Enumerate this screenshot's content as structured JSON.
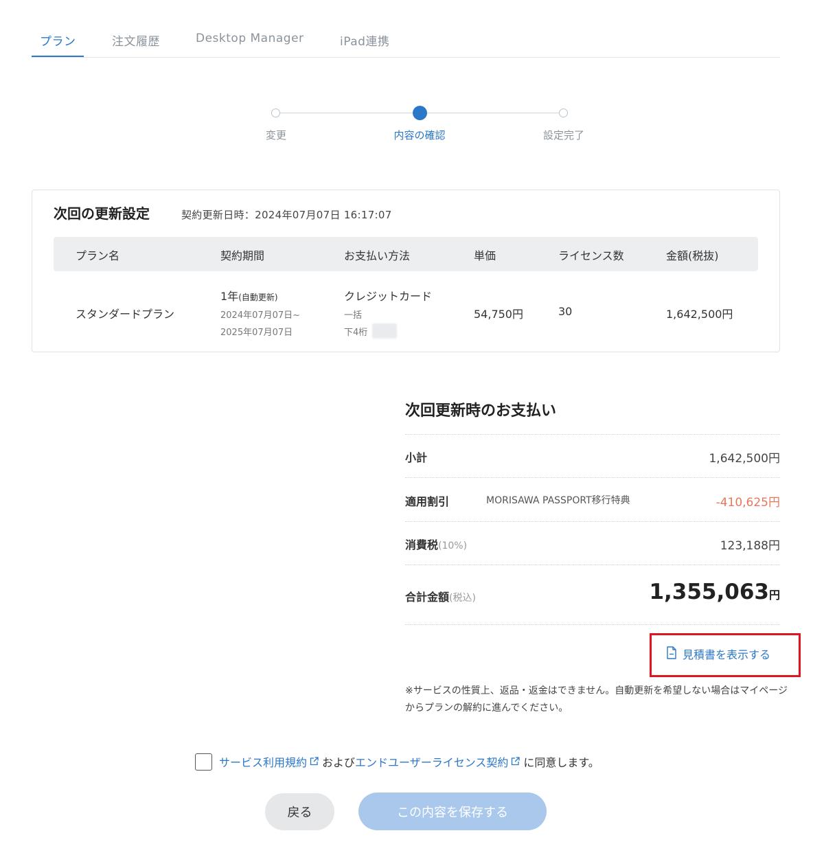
{
  "tabs": [
    {
      "label": "プラン"
    },
    {
      "label": "注文履歴"
    },
    {
      "label": "Desktop Manager"
    },
    {
      "label": "iPad連携"
    }
  ],
  "stepper": {
    "steps": [
      {
        "label": "変更"
      },
      {
        "label": "内容の確認"
      },
      {
        "label": "設定完了"
      }
    ]
  },
  "renewal": {
    "title": "次回の更新設定",
    "renewal_datetime": "契約更新日時：2024年07月07日 16:17:07",
    "headers": [
      "プラン名",
      "契約期間",
      "お支払い方法",
      "単価",
      "ライセンス数",
      "金額(税抜)"
    ],
    "row": {
      "plan_name": "スタンダードプラン",
      "term": "1年",
      "term_note": "(自動更新)",
      "term_start": "2024年07月07日~",
      "term_end": "2025年07月07日",
      "payment_method": "クレジットカード",
      "payment_type": "一括",
      "card_last4_label": "下4桁",
      "unit_price": "54,750円",
      "licenses": "30",
      "amount": "1,642,500円"
    }
  },
  "summary": {
    "title": "次回更新時のお支払い",
    "subtotal_label": "小計",
    "subtotal_value": "1,642,500円",
    "discount_label": "適用割引",
    "discount_note": "MORISAWA PASSPORT移行特典",
    "discount_value": "-410,625円",
    "tax_label": "消費税",
    "tax_rate": "(10%)",
    "tax_value": "123,188円",
    "total_label": "合計金額",
    "total_note": "(税込)",
    "total_value": "1,355,063",
    "total_unit": "円"
  },
  "estimate_link": "見積書を表示する",
  "disclaimer": "※サービスの性質上、返品・返金はできません。自動更新を希望しない場合はマイページからプランの解約に進んでください。",
  "agreement": {
    "terms_link": "サービス利用規約",
    "and_text": "および",
    "eula_link": "エンドユーザーライセンス契約",
    "suffix": "に同意します。"
  },
  "buttons": {
    "back": "戻る",
    "save": "この内容を保存する"
  },
  "colors": {
    "accent": "#2b77c8",
    "discount": "#e8765c",
    "highlight": "#e0141e",
    "save_disabled": "#a9c8ec"
  }
}
